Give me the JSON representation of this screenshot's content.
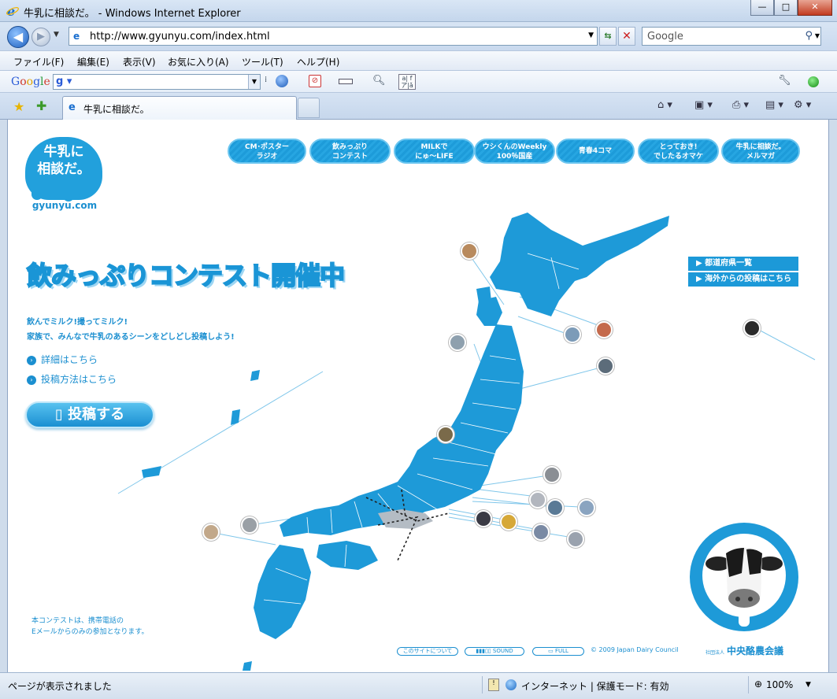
{
  "window": {
    "title": "牛乳に相談だ。 - Windows Internet Explorer",
    "buttons": {
      "minimize": "—",
      "maximize": "□",
      "close": "✕"
    }
  },
  "address": {
    "url": "http://www.gyunyu.com/index.html",
    "search_placeholder": "Google"
  },
  "menu": [
    "ファイル(F)",
    "編集(E)",
    "表示(V)",
    "お気に入り(A)",
    "ツール(T)",
    "ヘルプ(H)"
  ],
  "googlebar": {
    "logo": [
      "G",
      "o",
      "o",
      "g",
      "l",
      "e"
    ]
  },
  "tab": {
    "label": "牛乳に相談だ。"
  },
  "page": {
    "logo": {
      "line1": "牛乳に",
      "line2": "相談だ。",
      "url": "gyunyu.com"
    },
    "nav": [
      {
        "line1": "CM･ポスター",
        "line2": "ラジオ"
      },
      {
        "line1": "飲みっぷり",
        "line2": "コンテスト"
      },
      {
        "line1": "MILKで",
        "line2": "にゅ～LIFE"
      },
      {
        "line1": "ウシくんのWeekly",
        "line2": "100％国産"
      },
      {
        "line1": "青春4コマ",
        "line2": ""
      },
      {
        "line1": "とっておき!",
        "line2": "でしたるオマケ"
      },
      {
        "line1": "牛乳に相談だ。",
        "line2": "メルマガ"
      }
    ],
    "headline": "飲みっぷりコンテスト開催中",
    "lead_line1": "飲んでミルク!撮ってミルク!",
    "lead_line2": "家族で、みんなで牛乳のあるシーンをどしどし投稿しよう!",
    "links": [
      "詳細はこちら",
      "投稿方法はこちら"
    ],
    "post_button": "投稿する",
    "pref_buttons": [
      "都道府県一覧",
      "海外からの投稿はこちら"
    ],
    "footer_note_line1": "本コンテストは、携帯電話の",
    "footer_note_line2": "Eメールからのみの参加となります。",
    "footer_buttons": [
      "このサイトについて",
      "SOUND",
      "FULL"
    ],
    "copyright": "© 2009 Japan Dairy Council",
    "council_prefix": "社団法人",
    "council_name": "中央酪農会議",
    "colors": {
      "brand_blue": "#1b9ad8"
    }
  },
  "status": {
    "text": "ページが表示されました",
    "zone": "インターネット | 保護モード: 有効",
    "zoom": "100%"
  }
}
